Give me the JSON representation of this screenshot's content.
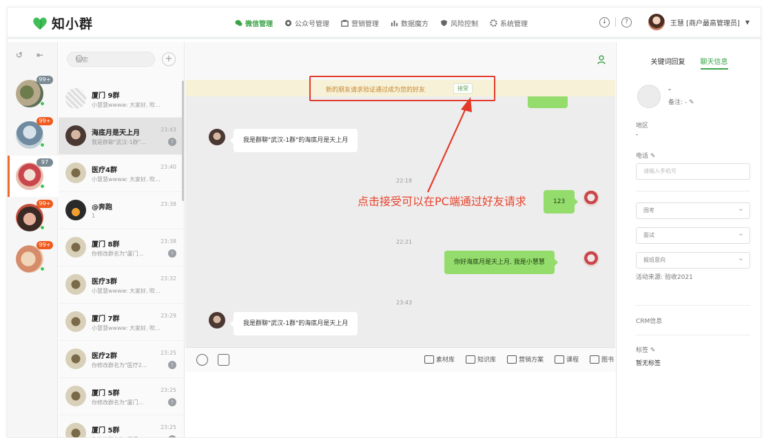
{
  "app": {
    "name": "知小群",
    "user": "王慧 [商户最高管理员]"
  },
  "nav": [
    {
      "label": "微信管理",
      "icon": "wechat-icon",
      "active": true
    },
    {
      "label": "公众号管理",
      "icon": "official-account-icon"
    },
    {
      "label": "营销管理",
      "icon": "marketing-icon"
    },
    {
      "label": "数据魔方",
      "icon": "chart-icon"
    },
    {
      "label": "风险控制",
      "icon": "shield-icon"
    },
    {
      "label": "系统管理",
      "icon": "gear-icon"
    }
  ],
  "rail": {
    "badges": [
      "99+",
      "99+",
      "97",
      "99+",
      "99+"
    ]
  },
  "search": {
    "placeholder": "搜索"
  },
  "chats": [
    {
      "name": "厦门 9群",
      "time": "",
      "preview": "小慧慧wwww: 大家好, 吹..."
    },
    {
      "name": "海底月是天上月",
      "time": "23:43",
      "preview": "我是群聊\"武汉-1群\"...",
      "mark": "!"
    },
    {
      "name": "医疗4群",
      "time": "23:40",
      "preview": "小慧慧wwww: 大家好, 吹..."
    },
    {
      "name": "@奔跑",
      "time": "23:38",
      "preview": "1"
    },
    {
      "name": "厦门 8群",
      "time": "23:38",
      "preview": "你修改群名为\"厦门...",
      "mark": "!"
    },
    {
      "name": "医疗3群",
      "time": "23:32",
      "preview": "小慧慧wwww: 大家好, 吹..."
    },
    {
      "name": "厦门 7群",
      "time": "23:29",
      "preview": "小慧慧wwww: 大家好, 吹..."
    },
    {
      "name": "医疗2群",
      "time": "23:25",
      "preview": "你修改群名为\"医疗2...",
      "mark": "!"
    },
    {
      "name": "厦门 5群",
      "time": "23:25",
      "preview": "你修改群名为\"厦门...",
      "mark": "!"
    },
    {
      "name": "厦门 5群",
      "time": "23:25",
      "preview": "你修改群名为\"厦门...",
      "mark": "!"
    }
  ],
  "notice": {
    "text": "新的朋友请求验证通过成为您的好友",
    "accept": "接受"
  },
  "annotation": "点击接受可以在PC端通过好友请求",
  "messages": {
    "m1": "我是群聊\"武汉-1群\"的海底月是天上月",
    "t1": "22:18",
    "m2": "123",
    "t2": "22:21",
    "m3": "你好海底月是天上月, 我是小慧慧",
    "t3": "23:43",
    "m4": "我是群聊\"武汉-1群\"的海底月是天上月"
  },
  "toolbar": [
    "素材库",
    "知识库",
    "营销方案",
    "课程",
    "图书"
  ],
  "rpanel": {
    "tab1": "关键词回复",
    "tab2": "聊天信息",
    "name": "-",
    "note": "备注: -",
    "region_label": "地区",
    "region_val": "-",
    "phone_label": "电话",
    "phone_placeholder": "请输入手机号",
    "select1": "国考",
    "select2": "面试",
    "select3": "报班意向",
    "source": "活动来源:  验收2021",
    "crm": "CRM信息",
    "tag_label": "标签",
    "tag_val": "暂无标签"
  }
}
